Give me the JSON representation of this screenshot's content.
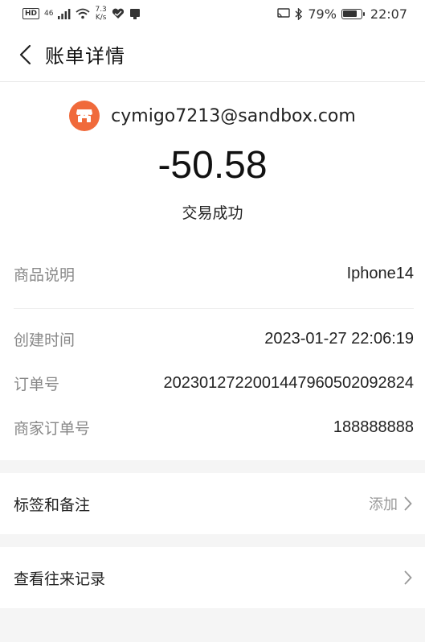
{
  "status_bar": {
    "hd": "HD",
    "network_top": "46",
    "network_bottom": "ıl",
    "speed_value": "7.3",
    "speed_unit": "K/s",
    "battery_percent": "79%",
    "battery_level": 0.79,
    "time": "22:07"
  },
  "nav": {
    "title": "账单详情"
  },
  "summary": {
    "merchant": "cymigo7213@sandbox.com",
    "amount": "-50.58",
    "status": "交易成功"
  },
  "details": {
    "goods_label": "商品说明",
    "goods_value": "Iphone14",
    "created_label": "创建时间",
    "created_value": "2023-01-27 22:06:19",
    "order_label": "订单号",
    "order_value": "2023012722001447960502092824",
    "merchant_order_label": "商家订单号",
    "merchant_order_value": "188888888"
  },
  "tags": {
    "label": "标签和备注",
    "action": "添加"
  },
  "records": {
    "label": "查看往来记录"
  },
  "colors": {
    "merchant_logo": "#f06a3b"
  }
}
